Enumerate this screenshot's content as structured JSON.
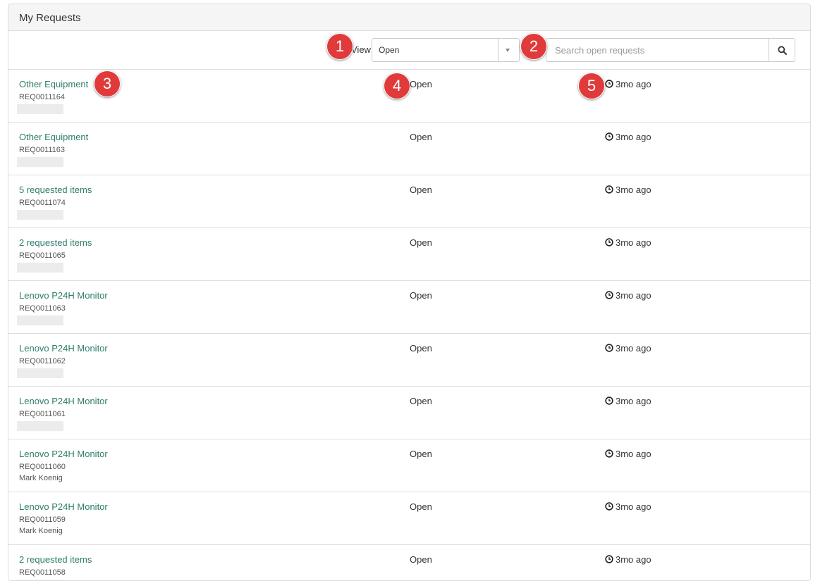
{
  "panel": {
    "title": "My Requests"
  },
  "toolbar": {
    "view_label": "View",
    "view_value": "Open",
    "search_placeholder": "Search open requests",
    "search_icon": "search-icon"
  },
  "requests": [
    {
      "title": "Other Equipment",
      "number": "REQ0011164",
      "requester": "",
      "state": "Open",
      "updated": "3mo ago"
    },
    {
      "title": "Other Equipment",
      "number": "REQ0011163",
      "requester": "",
      "state": "Open",
      "updated": "3mo ago"
    },
    {
      "title": "5 requested items",
      "number": "REQ0011074",
      "requester": "",
      "state": "Open",
      "updated": "3mo ago"
    },
    {
      "title": "2 requested items",
      "number": "REQ0011065",
      "requester": "",
      "state": "Open",
      "updated": "3mo ago"
    },
    {
      "title": "Lenovo P24H Monitor",
      "number": "REQ0011063",
      "requester": "",
      "state": "Open",
      "updated": "3mo ago"
    },
    {
      "title": "Lenovo P24H Monitor",
      "number": "REQ0011062",
      "requester": "",
      "state": "Open",
      "updated": "3mo ago"
    },
    {
      "title": "Lenovo P24H Monitor",
      "number": "REQ0011061",
      "requester": "",
      "state": "Open",
      "updated": "3mo ago"
    },
    {
      "title": "Lenovo P24H Monitor",
      "number": "REQ0011060",
      "requester": "Mark Koenig",
      "state": "Open",
      "updated": "3mo ago"
    },
    {
      "title": "Lenovo P24H Monitor",
      "number": "REQ0011059",
      "requester": "Mark Koenig",
      "state": "Open",
      "updated": "3mo ago"
    },
    {
      "title": "2 requested items",
      "number": "REQ0011058",
      "requester": "",
      "state": "Open",
      "updated": "3mo ago"
    }
  ],
  "markers": [
    "1",
    "2",
    "3",
    "4",
    "5"
  ],
  "colors": {
    "link": "#2e7d6b",
    "marker": "#e03a3a",
    "heading_bg": "#f5f5f5"
  }
}
